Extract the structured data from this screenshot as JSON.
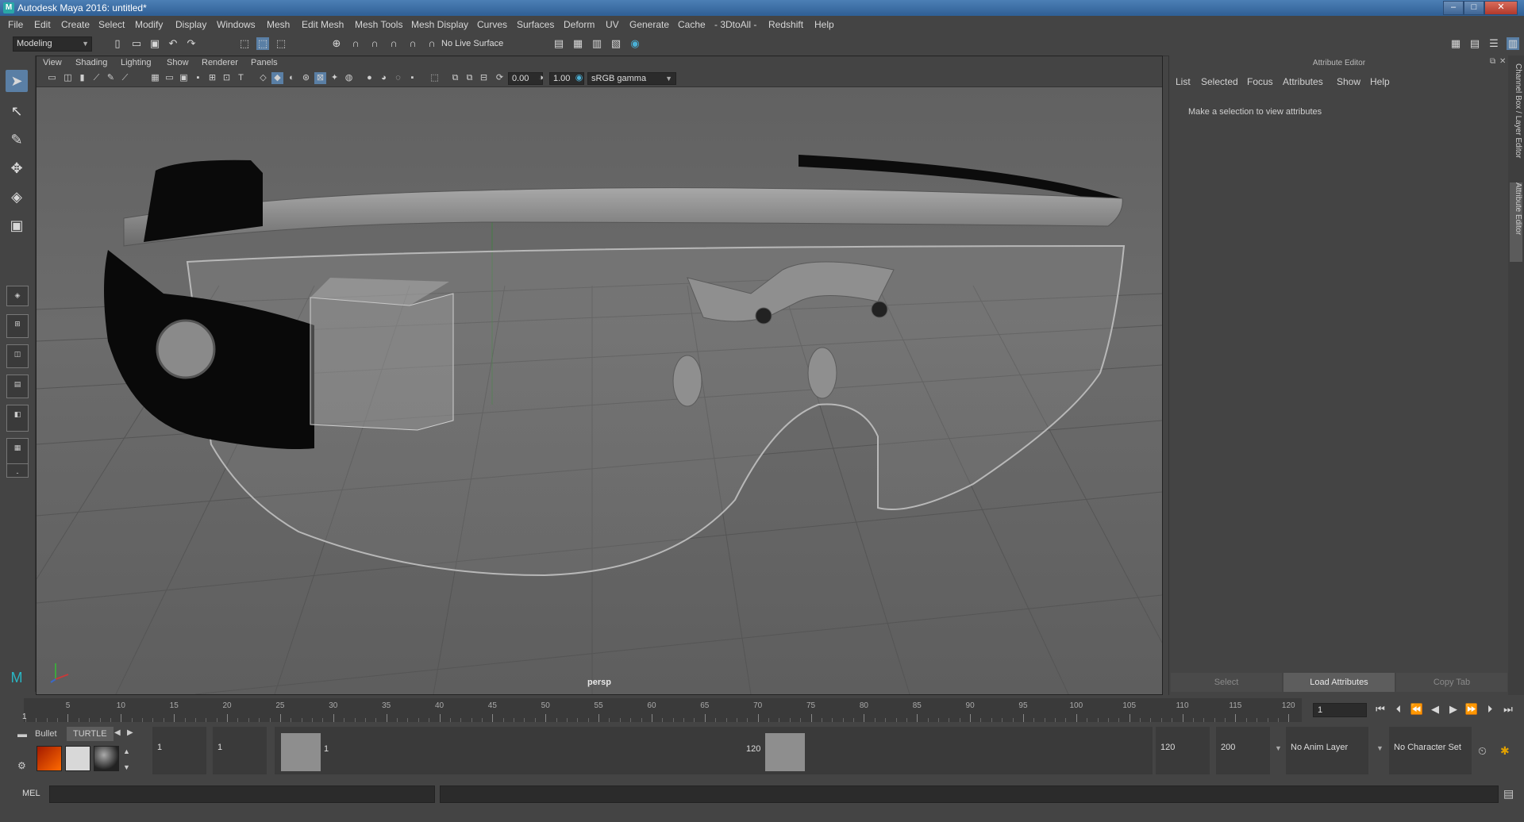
{
  "window": {
    "title": "Autodesk Maya 2016: untitled*",
    "logo": "M",
    "buttons": {
      "minimize": "–",
      "maximize": "□",
      "close": "✕"
    }
  },
  "menubar": [
    "File",
    "Edit",
    "Create",
    "Select",
    "Modify",
    "Display",
    "Windows",
    "Mesh",
    "Edit Mesh",
    "Mesh Tools",
    "Mesh Display",
    "Curves",
    "Surfaces",
    "Deform",
    "UV",
    "Generate",
    "Cache",
    "- 3DtoAll -",
    "Redshift",
    "Help"
  ],
  "statusline": {
    "menuset": "Modeling",
    "live_surface": "No Live Surface"
  },
  "viewport": {
    "menus": [
      "View",
      "Shading",
      "Lighting",
      "Show",
      "Renderer",
      "Panels"
    ],
    "exposure": "0.00",
    "gamma": "1.00",
    "color_space": "sRGB gamma",
    "camera": "persp"
  },
  "attribute_editor": {
    "title": "Attribute Editor",
    "menus": [
      "List",
      "Selected",
      "Focus",
      "Attributes",
      "Show",
      "Help"
    ],
    "message": "Make a selection to view attributes",
    "buttons": {
      "select": "Select",
      "load": "Load Attributes",
      "copy": "Copy Tab"
    }
  },
  "side_tabs": {
    "channel_box": "Channel Box / Layer Editor",
    "attribute_editor": "Attribute Editor"
  },
  "timeslider": {
    "ticks": [
      "5",
      "10",
      "15",
      "20",
      "25",
      "30",
      "35",
      "40",
      "45",
      "50",
      "55",
      "60",
      "65",
      "70",
      "75",
      "80",
      "85",
      "90",
      "95",
      "100",
      "105",
      "110",
      "115",
      "120"
    ],
    "current_frame_label": "1",
    "current_frame": "1"
  },
  "range": {
    "shelf_tabs": [
      "Bullet",
      "TURTLE"
    ],
    "start": "1",
    "anim_start": "1",
    "range_start_label": "1",
    "range_end_label": "120",
    "anim_end": "120",
    "end": "200",
    "anim_layer": "No Anim Layer",
    "character_set": "No Character Set"
  },
  "cmdline": {
    "label": "MEL"
  }
}
